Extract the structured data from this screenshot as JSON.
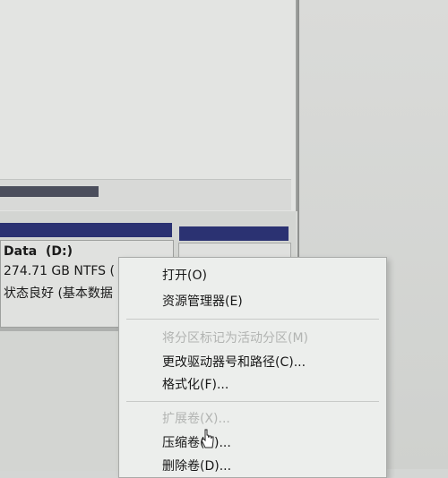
{
  "volume": {
    "name": "Data  (D:)",
    "size": "274.71 GB NTFS (",
    "status": "状态良好 (基本数据"
  },
  "context_menu": {
    "items": [
      {
        "label": "打开(O)",
        "enabled": true
      },
      {
        "label": "资源管理器(E)",
        "enabled": true
      },
      {
        "label": "将分区标记为活动分区(M)",
        "enabled": false
      },
      {
        "label": "更改驱动器号和路径(C)...",
        "enabled": true
      },
      {
        "label": "格式化(F)...",
        "enabled": true
      },
      {
        "label": "扩展卷(X)...",
        "enabled": false
      },
      {
        "label": "压缩卷(H)...",
        "enabled": true
      },
      {
        "label": "删除卷(D)...",
        "enabled": true
      }
    ]
  },
  "colors": {
    "volume_header": "#2b3272",
    "scroll_thumb": "#4b4e5c"
  }
}
